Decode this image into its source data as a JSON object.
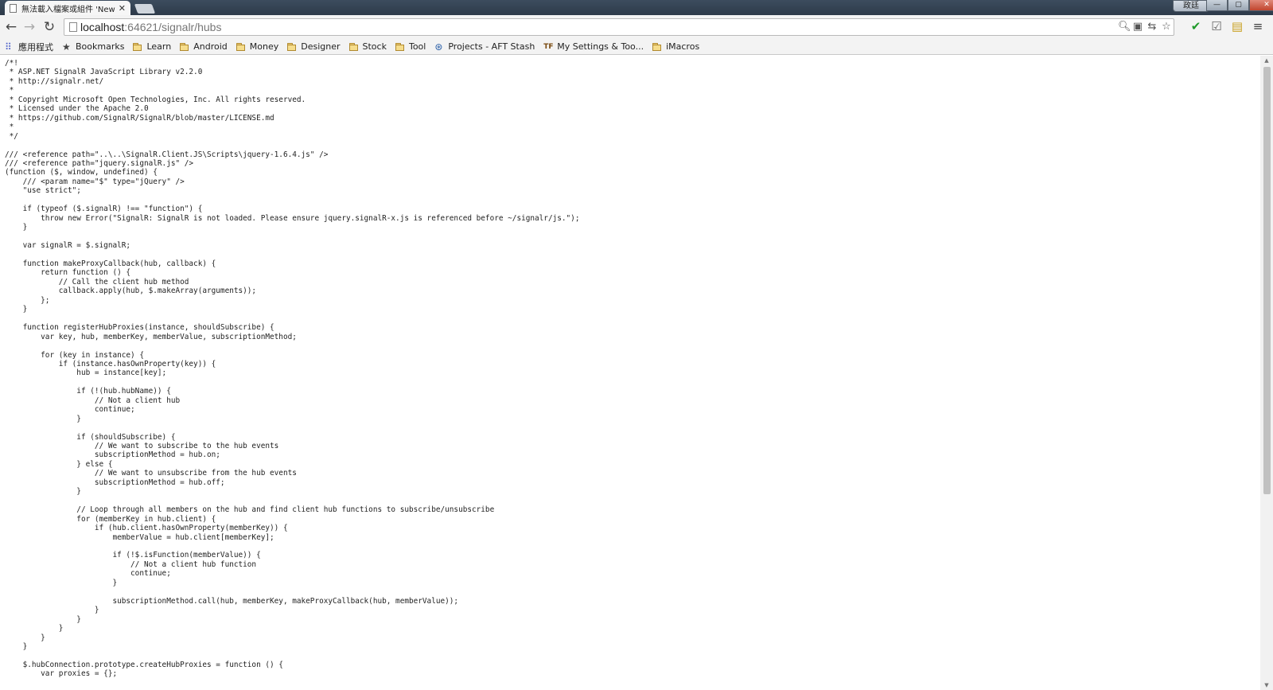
{
  "browser": {
    "tab": {
      "title": "無法載入檔案或組件 'New",
      "close_glyph": "✕"
    },
    "profile_button": "政廷",
    "window_controls": {
      "minimize": "—",
      "maximize": "▢",
      "close": "✕"
    },
    "nav": {
      "back": "←",
      "forward": "→",
      "reload": "↻"
    },
    "address": {
      "host": "localhost",
      "rest": ":64621/signalr/hubs"
    },
    "omnibox_icons": [
      "zoom-icon",
      "page-action-icon",
      "translate-icon",
      "star-icon"
    ],
    "extension_icons": [
      "check-extension-icon",
      "checkbox-extension-icon",
      "lock-extension-icon",
      "menu-icon"
    ]
  },
  "bookmarks": [
    {
      "icon": "apps",
      "label": "應用程式"
    },
    {
      "icon": "star",
      "label": "Bookmarks"
    },
    {
      "icon": "folder",
      "label": "Learn"
    },
    {
      "icon": "folder",
      "label": "Android"
    },
    {
      "icon": "folder",
      "label": "Money"
    },
    {
      "icon": "folder",
      "label": "Designer"
    },
    {
      "icon": "folder",
      "label": "Stock"
    },
    {
      "icon": "folder",
      "label": "Tool"
    },
    {
      "icon": "project",
      "label": "Projects - AFT Stash"
    },
    {
      "icon": "tf",
      "label": "My Settings & Too..."
    },
    {
      "icon": "folder",
      "label": "iMacros"
    }
  ],
  "page": {
    "code": "/*!\n * ASP.NET SignalR JavaScript Library v2.2.0\n * http://signalr.net/\n *\n * Copyright Microsoft Open Technologies, Inc. All rights reserved.\n * Licensed under the Apache 2.0\n * https://github.com/SignalR/SignalR/blob/master/LICENSE.md\n *\n */\n\n/// <reference path=\"..\\..\\SignalR.Client.JS\\Scripts\\jquery-1.6.4.js\" />\n/// <reference path=\"jquery.signalR.js\" />\n(function ($, window, undefined) {\n    /// <param name=\"$\" type=\"jQuery\" />\n    \"use strict\";\n\n    if (typeof ($.signalR) !== \"function\") {\n        throw new Error(\"SignalR: SignalR is not loaded. Please ensure jquery.signalR-x.js is referenced before ~/signalr/js.\");\n    }\n\n    var signalR = $.signalR;\n\n    function makeProxyCallback(hub, callback) {\n        return function () {\n            // Call the client hub method\n            callback.apply(hub, $.makeArray(arguments));\n        };\n    }\n\n    function registerHubProxies(instance, shouldSubscribe) {\n        var key, hub, memberKey, memberValue, subscriptionMethod;\n\n        for (key in instance) {\n            if (instance.hasOwnProperty(key)) {\n                hub = instance[key];\n\n                if (!(hub.hubName)) {\n                    // Not a client hub\n                    continue;\n                }\n\n                if (shouldSubscribe) {\n                    // We want to subscribe to the hub events\n                    subscriptionMethod = hub.on;\n                } else {\n                    // We want to unsubscribe from the hub events\n                    subscriptionMethod = hub.off;\n                }\n\n                // Loop through all members on the hub and find client hub functions to subscribe/unsubscribe\n                for (memberKey in hub.client) {\n                    if (hub.client.hasOwnProperty(memberKey)) {\n                        memberValue = hub.client[memberKey];\n\n                        if (!$.isFunction(memberValue)) {\n                            // Not a client hub function\n                            continue;\n                        }\n\n                        subscriptionMethod.call(hub, memberKey, makeProxyCallback(hub, memberValue));\n                    }\n                }\n            }\n        }\n    }\n\n    $.hubConnection.prototype.createHubProxies = function () {\n        var proxies = {};"
  },
  "scrollbar": {
    "up_arrow": "▲",
    "down_arrow": "▼",
    "position_fraction": 0.0
  }
}
